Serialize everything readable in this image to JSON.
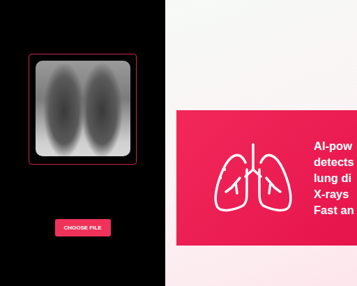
{
  "upload": {
    "button": "CHOOSE FILE"
  },
  "banner": {
    "lines": [
      "AI-pow",
      "detects",
      "lung di",
      "X-rays",
      "Fast an"
    ]
  }
}
